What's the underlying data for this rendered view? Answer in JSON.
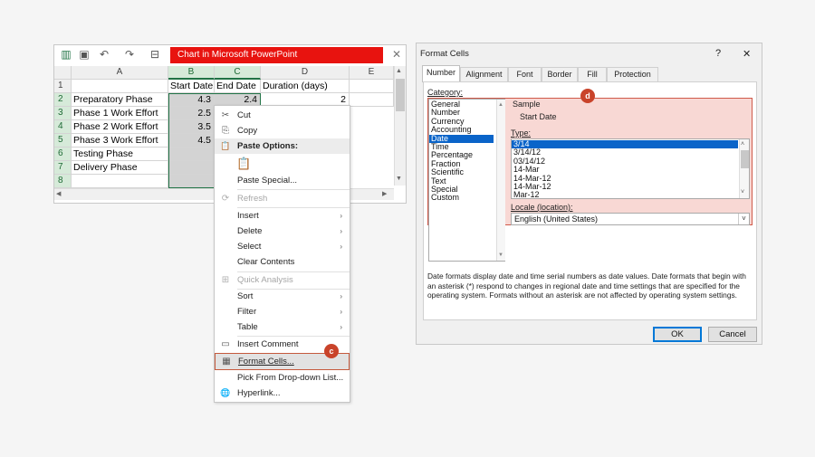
{
  "excel": {
    "title": "Chart in Microsoft PowerPoint",
    "close_glyph": "✕",
    "columns": [
      "A",
      "B",
      "C",
      "D",
      "E"
    ],
    "rows": [
      "1",
      "2",
      "3",
      "4",
      "5",
      "6",
      "7",
      "8"
    ],
    "header_row": {
      "b": "Start Date",
      "c": "End Date",
      "d": "Duration (days)"
    },
    "data": [
      {
        "a": "Preparatory Phase",
        "b": "4.3",
        "c": "2.4",
        "d": "2"
      },
      {
        "a": "Phase 1 Work Effort",
        "b": "2.5",
        "c": "",
        "d": ""
      },
      {
        "a": "Phase 2 Work Effort",
        "b": "3.5",
        "c": "",
        "d": ""
      },
      {
        "a": "Phase 3 Work Effort",
        "b": "4.5",
        "c": "",
        "d": ""
      },
      {
        "a": "Testing Phase",
        "b": "",
        "c": "",
        "d": ""
      },
      {
        "a": "Delivery Phase",
        "b": "",
        "c": "",
        "d": ""
      }
    ]
  },
  "menu": {
    "items": [
      {
        "label": "Cut",
        "icon": "scissors-icon",
        "glyph": "✂"
      },
      {
        "label": "Copy",
        "icon": "copy-icon",
        "glyph": "⎘"
      },
      {
        "label": "Paste Options:",
        "icon": "paste-icon",
        "glyph": "📋"
      },
      {
        "label": "Paste Special...",
        "icon": "",
        "glyph": ""
      },
      {
        "label": "Refresh",
        "icon": "refresh-icon",
        "glyph": "⟳"
      },
      {
        "label": "Insert",
        "icon": "",
        "glyph": ""
      },
      {
        "label": "Delete",
        "icon": "",
        "glyph": ""
      },
      {
        "label": "Select",
        "icon": "",
        "glyph": ""
      },
      {
        "label": "Clear Contents",
        "icon": "",
        "glyph": ""
      },
      {
        "label": "Quick Analysis",
        "icon": "quick-analysis-icon",
        "glyph": "⊞"
      },
      {
        "label": "Sort",
        "icon": "",
        "glyph": ""
      },
      {
        "label": "Filter",
        "icon": "",
        "glyph": ""
      },
      {
        "label": "Table",
        "icon": "",
        "glyph": ""
      },
      {
        "label": "Insert Comment",
        "icon": "comment-icon",
        "glyph": "▭"
      },
      {
        "label": "Format Cells...",
        "icon": "format-cells-icon",
        "glyph": "▦"
      },
      {
        "label": "Pick From Drop-down List...",
        "icon": "",
        "glyph": ""
      },
      {
        "label": "Hyperlink...",
        "icon": "hyperlink-icon",
        "glyph": "🌐"
      }
    ],
    "arrow_glyph": "›",
    "badge_c": "c"
  },
  "dialog": {
    "title": "Format Cells",
    "help_glyph": "?",
    "close_glyph": "✕",
    "tabs": [
      "Number",
      "Alignment",
      "Font",
      "Border",
      "Fill",
      "Protection"
    ],
    "category_label": "Category:",
    "categories": [
      "General",
      "Number",
      "Currency",
      "Accounting",
      "Date",
      "Time",
      "Percentage",
      "Fraction",
      "Scientific",
      "Text",
      "Special",
      "Custom"
    ],
    "selected_category": "Date",
    "sample_label": "Sample",
    "sample_value": "Start Date",
    "type_label": "Type:",
    "types": [
      "3/14",
      "3/14/12",
      "03/14/12",
      "14-Mar",
      "14-Mar-12",
      "14-Mar-12",
      "Mar-12"
    ],
    "locale_label": "Locale (location):",
    "locale_value": "English (United States)",
    "description": "Date formats display date and time serial numbers as date values.  Date formats that begin with an asterisk (*) respond to changes in regional date and time settings that are specified for the operating system. Formats without an asterisk are not affected by operating system settings.",
    "ok_label": "OK",
    "cancel_label": "Cancel",
    "badge_d": "d"
  }
}
